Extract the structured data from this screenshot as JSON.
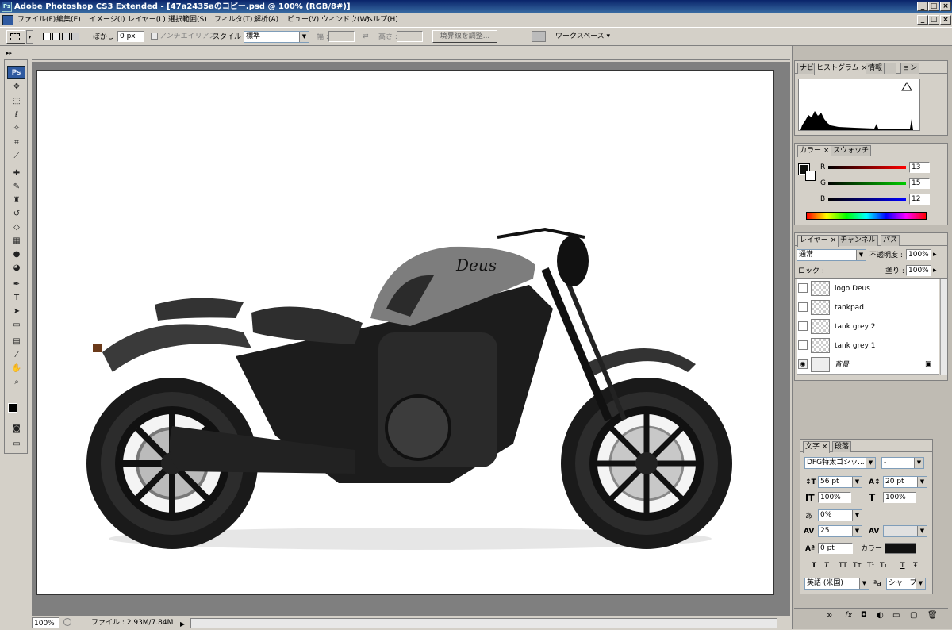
{
  "window": {
    "title": "Adobe Photoshop CS3 Extended - [47a2435aのコピー.psd @ 100% (RGB/8#)]",
    "app_icon": "Ps",
    "controls": [
      "_",
      "□",
      "×"
    ]
  },
  "menu": [
    "ファイル(F)",
    "編集(E)",
    "イメージ(I)",
    "レイヤー(L)",
    "選択範囲(S)",
    "フィルタ(T)",
    "解析(A)",
    "ビュー(V)",
    "ウィンドウ(W)",
    "ヘルプ(H)"
  ],
  "options": {
    "feather_label": "ぼかし :",
    "feather_value": "0 px",
    "antialias_label": "アンチエイリアス",
    "style_label": "スタイル :",
    "style_value": "標準",
    "width_label": "幅 :",
    "height_label": "高さ :",
    "refine_edge": "境界線を調整...",
    "workspace": "ワークスペース ▾"
  },
  "toolbox": {
    "logo": "Ps"
  },
  "canvas": {
    "logo_text": "Deus"
  },
  "status": {
    "zoom": "100%",
    "file": "ファイル : 2.93M/7.84M"
  },
  "panels": {
    "histogram": {
      "tabs": [
        "ナビ",
        "ヒストグラム ×",
        "情報",
        "ー",
        "ョン"
      ]
    },
    "color": {
      "tabs": [
        "カラー ×",
        "スウォッチ"
      ],
      "r_label": "R",
      "r_value": "13",
      "g_label": "G",
      "g_value": "15",
      "b_label": "B",
      "b_value": "12"
    },
    "layers": {
      "tabs": [
        "レイヤー ×",
        "チャンネル",
        "パス"
      ],
      "blend_mode": "通常",
      "opacity_label": "不透明度 :",
      "opacity_value": "100%",
      "lock_label": "ロック :",
      "fill_label": "塗り :",
      "fill_value": "100%",
      "items": [
        {
          "name": "logo Deus"
        },
        {
          "name": "tankpad"
        },
        {
          "name": "tank grey 2"
        },
        {
          "name": "tank grey 1"
        },
        {
          "name": "背景"
        }
      ]
    },
    "character": {
      "tabs": [
        "文字 ×",
        "段落"
      ],
      "font_family": "DFG特太ゴシッ...",
      "font_style": "-",
      "size": "56 pt",
      "leading": "20 pt",
      "vscale": "100%",
      "hscale": "100%",
      "tsume": "0%",
      "tracking": "25",
      "baseline": "0 pt",
      "color_label": "カラー :",
      "language": "英語 (米国)",
      "antialias": "シャープ",
      "aa_label": "ªa",
      "style_buttons": [
        "T",
        "T",
        "TT",
        "Tт",
        "T¹",
        "T₁",
        "T",
        "Ŧ"
      ]
    }
  }
}
